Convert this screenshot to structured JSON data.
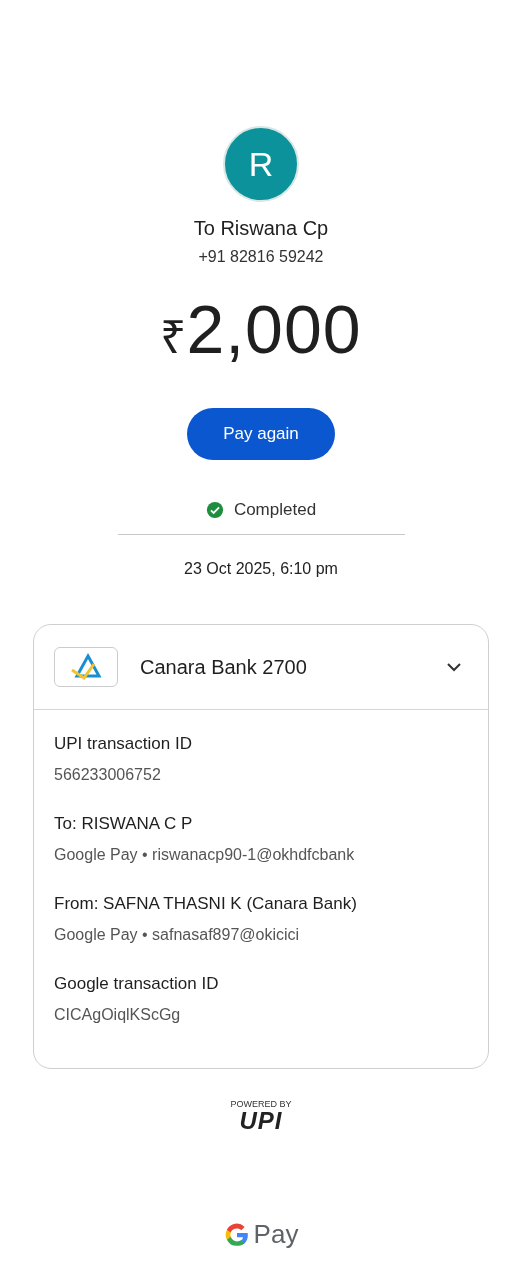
{
  "recipient": {
    "avatar_letter": "R",
    "name": "To Riswana Cp",
    "phone": "+91 82816 59242"
  },
  "amount": {
    "currency": "₹",
    "value": "2,000"
  },
  "action_button": "Pay again",
  "status": {
    "kind": "completed",
    "text": "Completed"
  },
  "date": "23 Oct 2025, 6:10 pm",
  "card": {
    "account": "Canara Bank 2700",
    "expanded": true,
    "details": [
      {
        "label": "UPI transaction ID",
        "value": "566233006752"
      },
      {
        "label": "To: RISWANA C P",
        "value": "Google Pay • riswanacp90-1@okhdfcbank"
      },
      {
        "label": "From: SAFNA THASNI K (Canara Bank)",
        "value": "Google Pay • safnasaf897@okicici"
      },
      {
        "label": "Google transaction ID",
        "value": "CICAgOiqlKScGg"
      }
    ]
  },
  "upi_badge": {
    "caption": "POWERED BY",
    "logo": "UPI"
  },
  "footer": {
    "brand": "Pay"
  }
}
